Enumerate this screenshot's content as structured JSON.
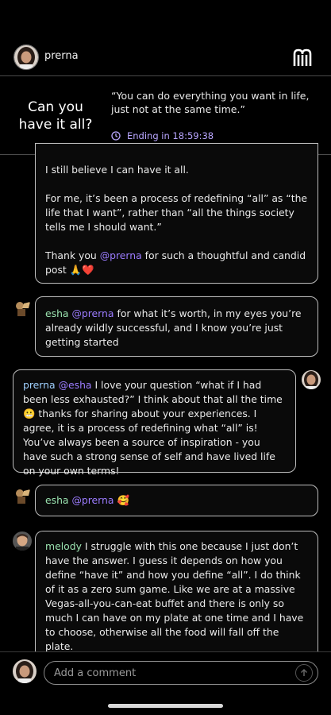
{
  "header": {
    "username": "prerna",
    "logo_icon": "brand-logo-icon"
  },
  "challenge": {
    "title": "Can you have it all?",
    "quote": "“You can do everything you want in life, just not at the same time.”",
    "timer_label": "Ending in 18:59:38",
    "timer_icon": "clock-icon"
  },
  "comments": [
    {
      "id": "c1",
      "paragraphs": [
        "I still believe I can have it all.",
        "For me, it’s been a process of redefining “all” as “the life that I want”, rather than “all the things society tells me I should want.”"
      ],
      "closing_pre": "Thank you ",
      "closing_mention": "@prerna",
      "closing_post": " for such a thoughtful and candid post 🙏❤️"
    },
    {
      "id": "c2",
      "username": "esha",
      "mention": "@prerna",
      "text": " for what it’s worth, in my eyes you’re already wildly successful, and I know you’re just getting started"
    },
    {
      "id": "c3",
      "username": "prerna",
      "mention": "@esha",
      "text": " I love your question “what if I had been less exhausted?” I think about that all the time 😬 thanks for sharing about your experiences. I agree, it is a process of redefining what “all” is! You’ve always been a source of inspiration - you have such a strong sense of self and have lived life on your own terms!"
    },
    {
      "id": "c4",
      "username": "esha",
      "mention": "@prerna",
      "text": " 🥰"
    },
    {
      "id": "c5",
      "username": "melody",
      "text": " I struggle with this one because I just don’t have the answer. I guess it depends on how you define “have it” and how you define “all”. I do think of it as a zero sum game. Like we are at a massive Vegas-all-you-can-eat buffet and there is only so much I can have on my plate at one time and I have to choose, otherwise all the food will fall off the plate."
    }
  ],
  "composer": {
    "placeholder": "Add a comment",
    "send_icon": "arrow-up-icon"
  },
  "colors": {
    "accent_purple": "#9c7cff",
    "username_green": "#9be3b0",
    "username_blue": "#9fd0ff",
    "timer_purple": "#b9a6ff"
  }
}
